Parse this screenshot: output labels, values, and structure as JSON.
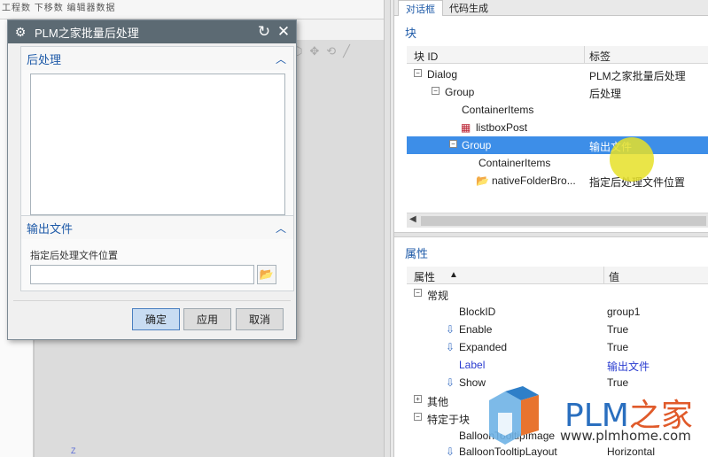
{
  "background": {
    "top_tabs": "工程数  下移数  编辑器数据",
    "z_label": "Z",
    "toolbar_icons": [
      "cube-icon",
      "move-icon",
      "rotate-icon",
      "line-icon"
    ]
  },
  "dialog": {
    "title": "PLM之家批量后处理",
    "section1_title": "后处理",
    "section2_title": "输出文件",
    "field_label": "指定后处理文件位置",
    "field_value": "",
    "buttons": {
      "ok": "确定",
      "apply": "应用",
      "cancel": "取消"
    }
  },
  "right_panel": {
    "tabs": [
      "对话框",
      "代码生成"
    ],
    "blocks": {
      "title": "块",
      "col1": "块 ID",
      "col2": "标签",
      "rows": [
        {
          "id": "Dialog",
          "label": "PLM之家批量后处理"
        },
        {
          "id": "Group",
          "label": "后处理"
        },
        {
          "id": "ContainerItems",
          "label": ""
        },
        {
          "id": "listboxPost",
          "label": ""
        },
        {
          "id": "Group",
          "label": "输出文件"
        },
        {
          "id": "ContainerItems",
          "label": ""
        },
        {
          "id": "nativeFolderBro...",
          "label": "指定后处理文件位置"
        }
      ]
    },
    "properties": {
      "title": "属性",
      "col1": "属性",
      "col2": "值",
      "rows": [
        {
          "name": "常规",
          "value": ""
        },
        {
          "name": "BlockID",
          "value": "group1"
        },
        {
          "name": "Enable",
          "value": "True"
        },
        {
          "name": "Expanded",
          "value": "True"
        },
        {
          "name": "Label",
          "value": "输出文件"
        },
        {
          "name": "Show",
          "value": "True"
        },
        {
          "name": "其他",
          "value": ""
        },
        {
          "name": "特定于块",
          "value": ""
        },
        {
          "name": "BalloonTooltipImage",
          "value": ""
        },
        {
          "name": "BalloonTooltipLayout",
          "value": "Horizontal"
        }
      ]
    }
  },
  "watermark": {
    "brand_plm": "PLM",
    "brand_home": "之家",
    "url": "www.plmhome.com"
  },
  "colors": {
    "selection": "#3d8ee8",
    "accent": "#1e5aa8",
    "title_bar": "#5c6a73",
    "highlight": "#e6e128"
  }
}
